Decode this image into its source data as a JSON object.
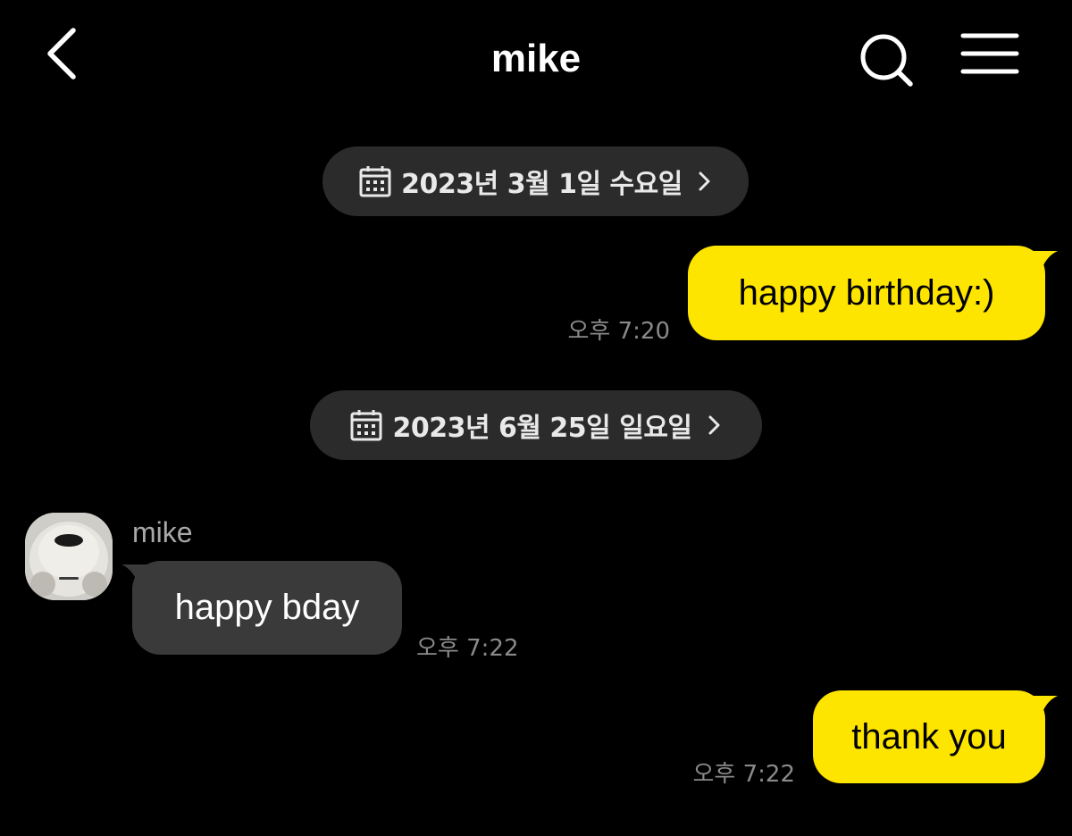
{
  "header": {
    "title": "mike",
    "back_icon": "chevron-left-icon",
    "search_icon": "search-icon",
    "menu_icon": "hamburger-menu-icon"
  },
  "colors": {
    "background": "#000000",
    "outgoing_bubble": "#fee500",
    "incoming_bubble": "#3a3a3a",
    "date_pill": "#2b2b2b",
    "timestamp": "#8a8a8a"
  },
  "dates": [
    {
      "label": "2023년 3월 1일 수요일",
      "icon": "calendar-icon"
    },
    {
      "label": "2023년 6월 25일 일요일",
      "icon": "calendar-icon"
    }
  ],
  "messages": [
    {
      "direction": "outgoing",
      "text": "happy birthday:)",
      "time": "오후 7:20"
    },
    {
      "direction": "incoming",
      "sender": "mike",
      "text": "happy bday",
      "time": "오후 7:22"
    },
    {
      "direction": "outgoing",
      "text": "thank you",
      "time": "오후 7:22"
    }
  ]
}
